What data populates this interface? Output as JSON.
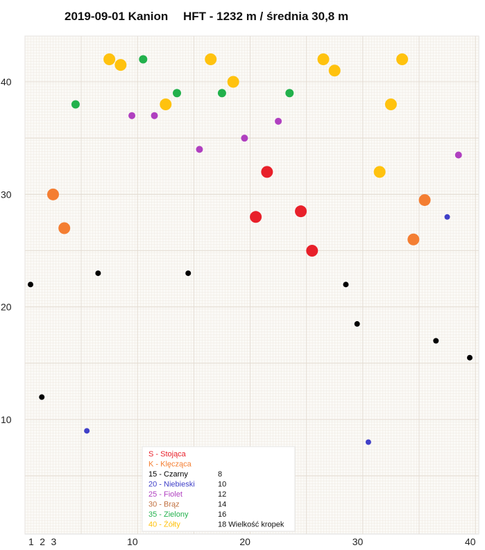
{
  "header": {
    "date_place": "2019-09-01 Kanion",
    "summary": "HFT - 1232 m / średnia 30,8 m"
  },
  "chart_data": {
    "type": "scatter",
    "title": "2019-09-01 Kanion     HFT - 1232 m / średnia 30,8 m",
    "xlabel": "",
    "ylabel": "",
    "xlim": [
      0.5,
      40.5
    ],
    "ylim": [
      0,
      44
    ],
    "x_ticks": [
      "1",
      "2",
      "3",
      "10",
      "20",
      "30",
      "40"
    ],
    "x_tick_values": [
      1,
      2,
      3,
      10,
      20,
      30,
      40
    ],
    "y_ticks": [
      "10",
      "20",
      "30",
      "40"
    ],
    "y_tick_values": [
      10,
      20,
      30,
      40
    ],
    "grid": true,
    "points": [
      {
        "x": 1,
        "y": 22,
        "color": "#000000",
        "size": 8
      },
      {
        "x": 2,
        "y": 12,
        "color": "#000000",
        "size": 8
      },
      {
        "x": 3,
        "y": 30,
        "color": "#f47e32",
        "size": 14
      },
      {
        "x": 4,
        "y": 27,
        "color": "#f47e32",
        "size": 14
      },
      {
        "x": 5,
        "y": 38,
        "color": "#22b14c",
        "size": 12
      },
      {
        "x": 6,
        "y": 9,
        "color": "#4040c8",
        "size": 8
      },
      {
        "x": 7,
        "y": 23,
        "color": "#000000",
        "size": 8
      },
      {
        "x": 8,
        "y": 42,
        "color": "#ffc20e",
        "size": 14
      },
      {
        "x": 9,
        "y": 41.5,
        "color": "#ffc20e",
        "size": 14
      },
      {
        "x": 10,
        "y": 37,
        "color": "#b040c0",
        "size": 10
      },
      {
        "x": 11,
        "y": 42,
        "color": "#22b14c",
        "size": 12
      },
      {
        "x": 12,
        "y": 37,
        "color": "#b040c0",
        "size": 10
      },
      {
        "x": 13,
        "y": 38,
        "color": "#ffc20e",
        "size": 14
      },
      {
        "x": 14,
        "y": 39,
        "color": "#22b14c",
        "size": 12
      },
      {
        "x": 15,
        "y": 23,
        "color": "#000000",
        "size": 8
      },
      {
        "x": 16,
        "y": 34,
        "color": "#b040c0",
        "size": 10
      },
      {
        "x": 17,
        "y": 42,
        "color": "#ffc20e",
        "size": 14
      },
      {
        "x": 18,
        "y": 39,
        "color": "#22b14c",
        "size": 12
      },
      {
        "x": 19,
        "y": 40,
        "color": "#ffc20e",
        "size": 14
      },
      {
        "x": 20,
        "y": 35,
        "color": "#b040c0",
        "size": 10
      },
      {
        "x": 21,
        "y": 28,
        "color": "#e8202a",
        "size": 14
      },
      {
        "x": 22,
        "y": 32,
        "color": "#e8202a",
        "size": 14
      },
      {
        "x": 23,
        "y": 36.5,
        "color": "#b040c0",
        "size": 10
      },
      {
        "x": 24,
        "y": 39,
        "color": "#22b14c",
        "size": 12
      },
      {
        "x": 25,
        "y": 28.5,
        "color": "#e8202a",
        "size": 14
      },
      {
        "x": 26,
        "y": 25,
        "color": "#e8202a",
        "size": 14
      },
      {
        "x": 27,
        "y": 42,
        "color": "#ffc20e",
        "size": 14
      },
      {
        "x": 28,
        "y": 41,
        "color": "#ffc20e",
        "size": 14
      },
      {
        "x": 29,
        "y": 22,
        "color": "#000000",
        "size": 8
      },
      {
        "x": 30,
        "y": 18.5,
        "color": "#000000",
        "size": 8
      },
      {
        "x": 31,
        "y": 8,
        "color": "#4040c8",
        "size": 8
      },
      {
        "x": 32,
        "y": 32,
        "color": "#ffc20e",
        "size": 14
      },
      {
        "x": 33,
        "y": 38,
        "color": "#ffc20e",
        "size": 14
      },
      {
        "x": 34,
        "y": 42,
        "color": "#ffc20e",
        "size": 14
      },
      {
        "x": 35,
        "y": 26,
        "color": "#f47e32",
        "size": 14
      },
      {
        "x": 36,
        "y": 29.5,
        "color": "#f47e32",
        "size": 14
      },
      {
        "x": 37,
        "y": 17,
        "color": "#000000",
        "size": 8
      },
      {
        "x": 38,
        "y": 28,
        "color": "#4040c8",
        "size": 8
      },
      {
        "x": 39,
        "y": 33.5,
        "color": "#b040c0",
        "size": 10
      },
      {
        "x": 40,
        "y": 15.5,
        "color": "#000000",
        "size": 8
      }
    ],
    "legend": {
      "position": "bottom-center",
      "rows": [
        {
          "label": "S  -  Stojąca",
          "value": "",
          "color": "#e8202a"
        },
        {
          "label": "K  - Klęcząca",
          "value": "",
          "color": "#f47e32"
        },
        {
          "label": "15 - Czarny",
          "value": "8",
          "color": "#000000"
        },
        {
          "label": "20 - Niebieski",
          "value": "10",
          "color": "#4040c8"
        },
        {
          "label": "25 - Fiolet",
          "value": "12",
          "color": "#b040c0"
        },
        {
          "label": "30 - Brąz",
          "value": "14",
          "color": "#c07040"
        },
        {
          "label": "35 - Zielony",
          "value": "16",
          "color": "#22b14c"
        },
        {
          "label": "40 - Żółty",
          "value": "18 Wielkość kropek",
          "color": "#ffc20e"
        }
      ]
    }
  }
}
